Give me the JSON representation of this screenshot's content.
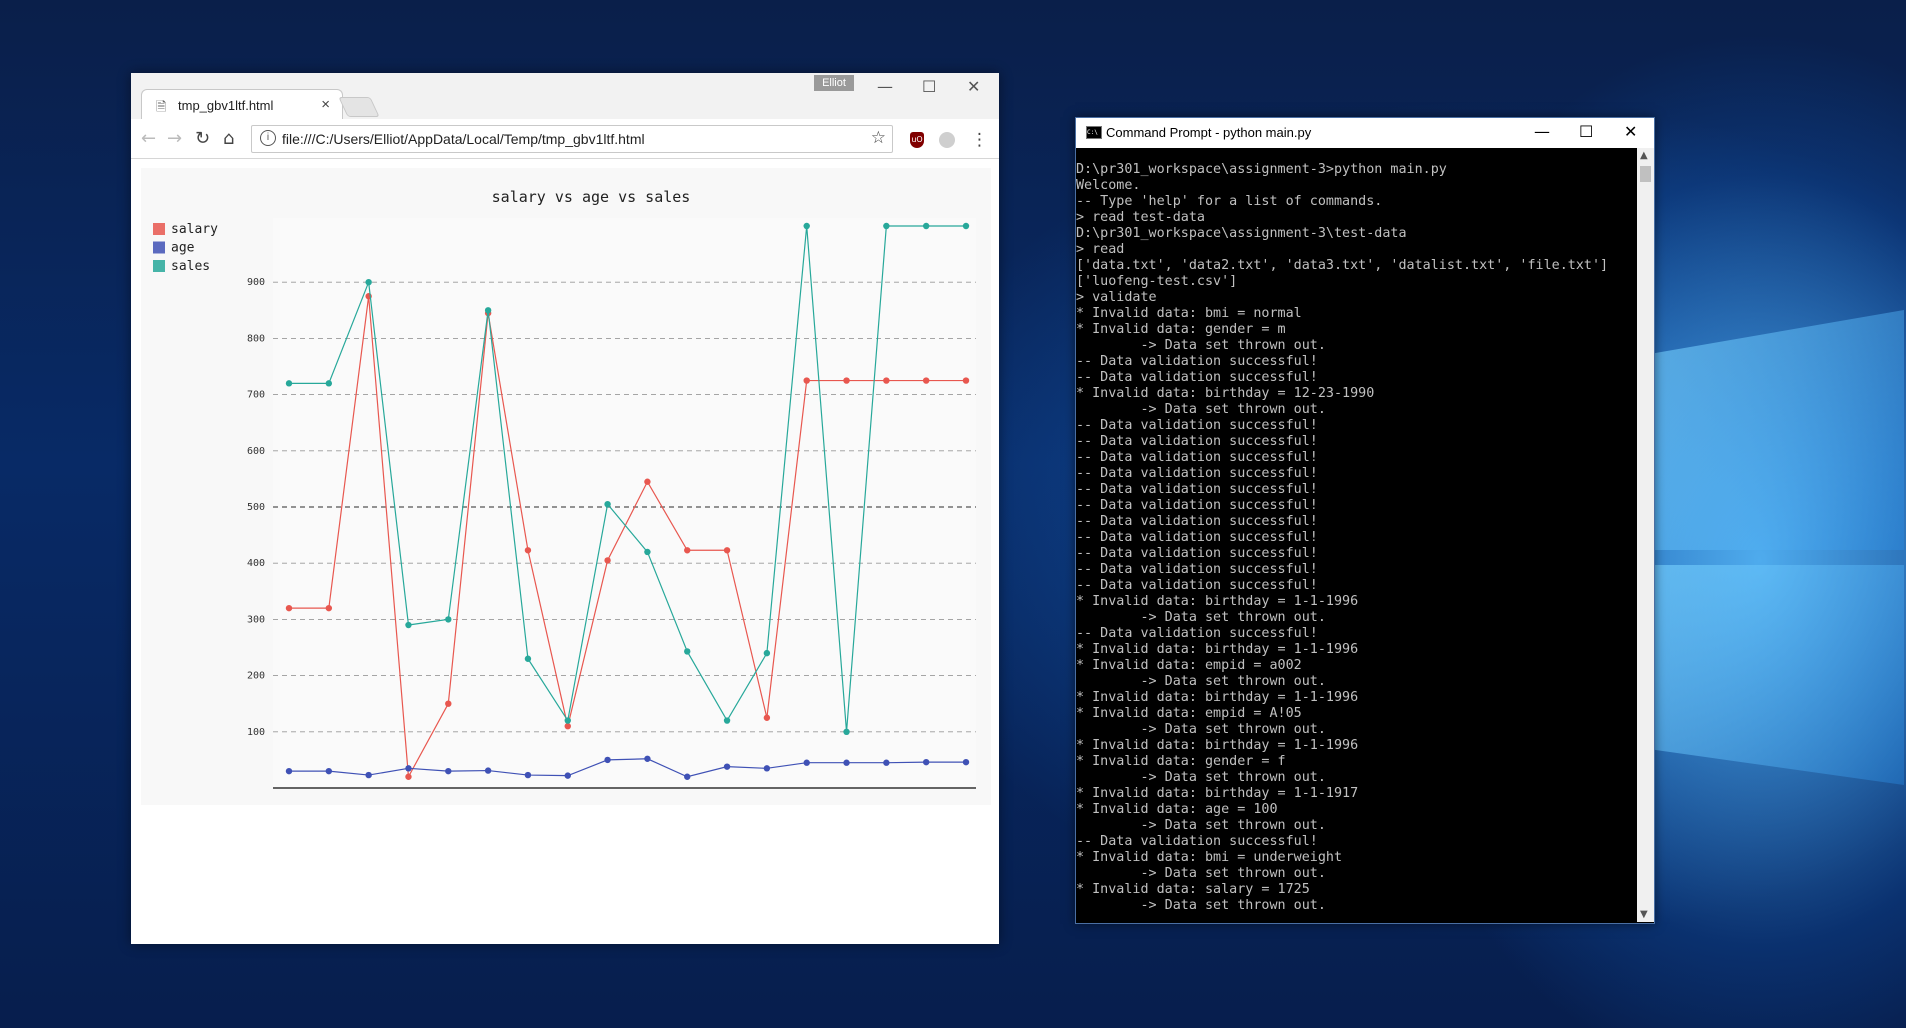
{
  "browser": {
    "tab_title": "tmp_gbv1ltf.html",
    "tab_close": "×",
    "profile_name": "Elliot",
    "url": "file:///C:/Users/Elliot/AppData/Local/Temp/tmp_gbv1ltf.html",
    "controls": {
      "minimize": "—",
      "maximize": "☐",
      "close": "✕"
    },
    "nav": {
      "back": "←",
      "forward": "→",
      "reload": "↻",
      "home": "⌂",
      "star": "☆",
      "menu": "⋮",
      "info": "i",
      "ublock": "uO"
    }
  },
  "chart_data": {
    "type": "line",
    "title": "salary vs age vs sales",
    "legend_position": "top-left",
    "grid": true,
    "ylim": [
      0,
      1000
    ],
    "yticks": [
      100,
      200,
      300,
      400,
      500,
      600,
      700,
      800,
      900
    ],
    "x": [
      1,
      2,
      3,
      4,
      5,
      6,
      7,
      8,
      9,
      10,
      11,
      12,
      13,
      14,
      15,
      16,
      17,
      18
    ],
    "series": [
      {
        "name": "salary",
        "color": "#e8574f",
        "values": [
          320,
          320,
          875,
          20,
          150,
          845,
          423,
          110,
          405,
          545,
          423,
          423,
          125,
          725,
          725,
          725,
          725,
          725
        ]
      },
      {
        "name": "age",
        "color": "#3f51b5",
        "values": [
          30,
          30,
          23,
          35,
          30,
          31,
          23,
          22,
          50,
          52,
          20,
          38,
          35,
          45,
          45,
          45,
          46,
          46
        ]
      },
      {
        "name": "sales",
        "color": "#27a89a",
        "values": [
          720,
          720,
          900,
          290,
          300,
          850,
          230,
          120,
          505,
          420,
          243,
          120,
          240,
          1000,
          100,
          1000,
          1000,
          1000
        ]
      }
    ]
  },
  "cmd": {
    "title": "Command Prompt - python  main.py",
    "controls": {
      "minimize": "—",
      "maximize": "☐",
      "close": "✕"
    },
    "lines": [
      "D:\\pr301_workspace\\assignment-3>python main.py",
      "Welcome.",
      "-- Type 'help' for a list of commands.",
      "> read test-data",
      "D:\\pr301_workspace\\assignment-3\\test-data",
      "> read",
      "['data.txt', 'data2.txt', 'data3.txt', 'datalist.txt', 'file.txt']",
      "['luofeng-test.csv']",
      "> validate",
      "* Invalid data: bmi = normal",
      "* Invalid data: gender = m",
      "        -> Data set thrown out.",
      "-- Data validation successful!",
      "-- Data validation successful!",
      "* Invalid data: birthday = 12-23-1990",
      "        -> Data set thrown out.",
      "-- Data validation successful!",
      "-- Data validation successful!",
      "-- Data validation successful!",
      "-- Data validation successful!",
      "-- Data validation successful!",
      "-- Data validation successful!",
      "-- Data validation successful!",
      "-- Data validation successful!",
      "-- Data validation successful!",
      "-- Data validation successful!",
      "-- Data validation successful!",
      "* Invalid data: birthday = 1-1-1996",
      "        -> Data set thrown out.",
      "-- Data validation successful!",
      "* Invalid data: birthday = 1-1-1996",
      "* Invalid data: empid = a002",
      "        -> Data set thrown out.",
      "* Invalid data: birthday = 1-1-1996",
      "* Invalid data: empid = A!05",
      "        -> Data set thrown out.",
      "* Invalid data: birthday = 1-1-1996",
      "* Invalid data: gender = f",
      "        -> Data set thrown out.",
      "* Invalid data: birthday = 1-1-1917",
      "* Invalid data: age = 100",
      "        -> Data set thrown out.",
      "-- Data validation successful!",
      "* Invalid data: bmi = underweight",
      "        -> Data set thrown out.",
      "* Invalid data: salary = 1725",
      "        -> Data set thrown out."
    ]
  }
}
